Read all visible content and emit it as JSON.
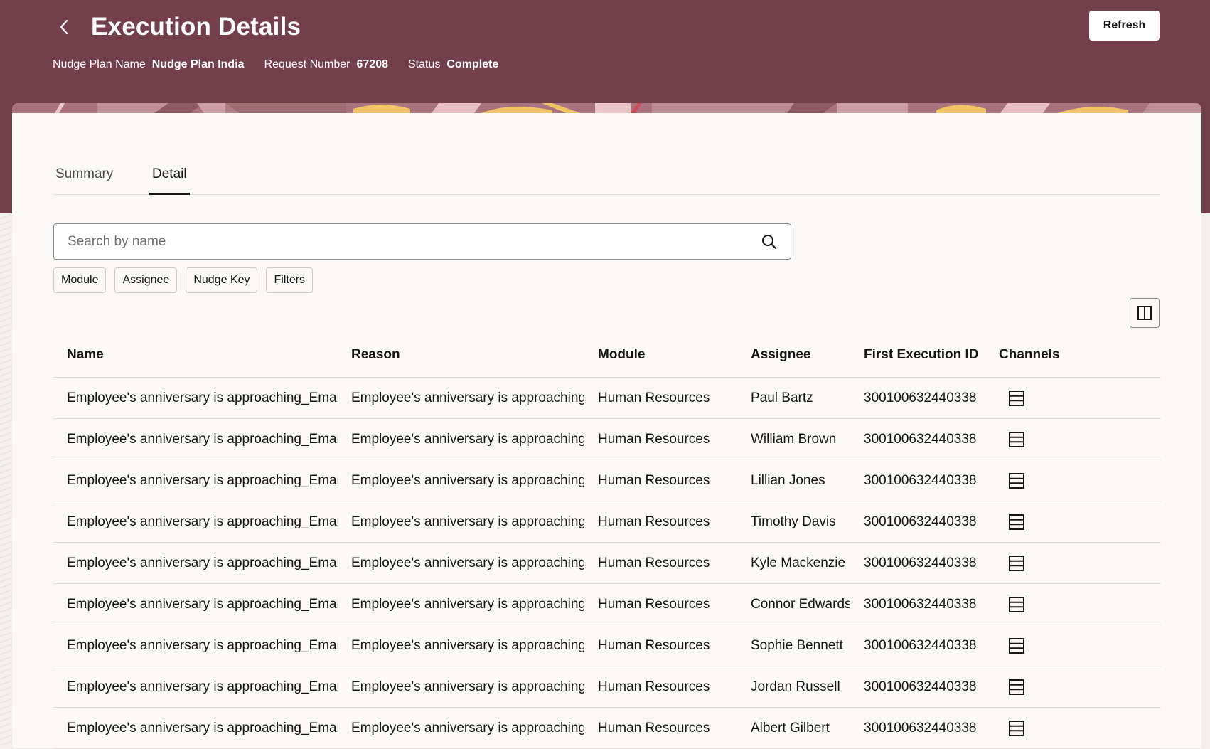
{
  "header": {
    "title": "Execution Details",
    "refresh_label": "Refresh",
    "meta": [
      {
        "label": "Nudge Plan Name",
        "value": "Nudge Plan India"
      },
      {
        "label": "Request Number",
        "value": "67208"
      },
      {
        "label": "Status",
        "value": "Complete"
      }
    ],
    "background_color": "#723f4b"
  },
  "tabs": [
    {
      "label": "Summary",
      "selected": false
    },
    {
      "label": "Detail",
      "selected": true
    }
  ],
  "search": {
    "placeholder": "Search by name",
    "value": "",
    "icon": "search-icon"
  },
  "filter_chips": [
    "Module",
    "Assignee",
    "Nudge Key",
    "Filters"
  ],
  "table": {
    "columns": [
      "Name",
      "Reason",
      "Module",
      "Assignee",
      "First Execution ID",
      "Channels"
    ],
    "rows": [
      {
        "name": "Employee's anniversary is approaching_Email",
        "reason": "Employee's anniversary is approaching",
        "module": "Human Resources",
        "assignee": "Paul Bartz",
        "first_execution_id": "300100632440338",
        "channel_icon": "list-icon"
      },
      {
        "name": "Employee's anniversary is approaching_Email",
        "reason": "Employee's anniversary is approaching",
        "module": "Human Resources",
        "assignee": "William Brown",
        "first_execution_id": "300100632440338",
        "channel_icon": "list-icon"
      },
      {
        "name": "Employee's anniversary is approaching_Email",
        "reason": "Employee's anniversary is approaching",
        "module": "Human Resources",
        "assignee": "Lillian Jones",
        "first_execution_id": "300100632440338",
        "channel_icon": "list-icon"
      },
      {
        "name": "Employee's anniversary is approaching_Email",
        "reason": "Employee's anniversary is approaching",
        "module": "Human Resources",
        "assignee": "Timothy Davis",
        "first_execution_id": "300100632440338",
        "channel_icon": "list-icon"
      },
      {
        "name": "Employee's anniversary is approaching_Email",
        "reason": "Employee's anniversary is approaching",
        "module": "Human Resources",
        "assignee": "Kyle Mackenzie",
        "first_execution_id": "300100632440338",
        "channel_icon": "list-icon"
      },
      {
        "name": "Employee's anniversary is approaching_Email",
        "reason": "Employee's anniversary is approaching",
        "module": "Human Resources",
        "assignee": "Connor Edwards",
        "first_execution_id": "300100632440338",
        "channel_icon": "list-icon"
      },
      {
        "name": "Employee's anniversary is approaching_Email",
        "reason": "Employee's anniversary is approaching",
        "module": "Human Resources",
        "assignee": "Sophie Bennett",
        "first_execution_id": "300100632440338",
        "channel_icon": "list-icon"
      },
      {
        "name": "Employee's anniversary is approaching_Email",
        "reason": "Employee's anniversary is approaching",
        "module": "Human Resources",
        "assignee": "Jordan Russell",
        "first_execution_id": "300100632440338",
        "channel_icon": "list-icon"
      },
      {
        "name": "Employee's anniversary is approaching_Email",
        "reason": "Employee's anniversary is approaching",
        "module": "Human Resources",
        "assignee": "Albert Gilbert",
        "first_execution_id": "300100632440338",
        "channel_icon": "list-icon"
      }
    ]
  }
}
